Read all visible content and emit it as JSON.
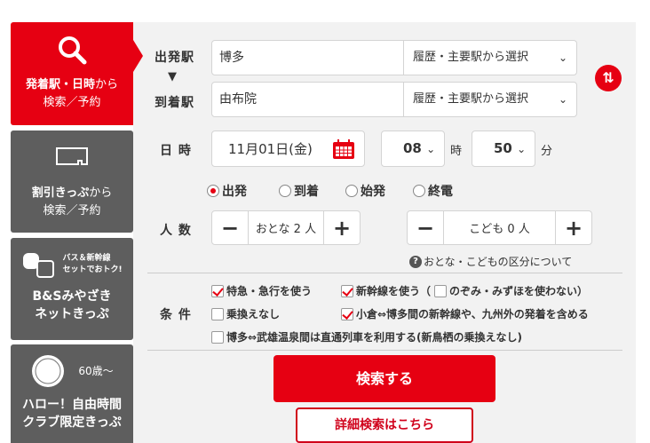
{
  "sidebar": {
    "items": [
      {
        "label_bold": "発着駅・日時",
        "label_rest": "から",
        "label2": "検索／予約",
        "active": true
      },
      {
        "label_bold": "割引きっぷ",
        "label_rest": "から",
        "label2": "検索／予約"
      },
      {
        "badge": "バス＆新幹線\nセットでおトク!",
        "label": "B&Sみやざき",
        "label2": "ネットきっぷ"
      },
      {
        "badge": "60歳～",
        "label": "ハロー！自由時間",
        "label2": "クラブ限定きっぷ"
      }
    ]
  },
  "form": {
    "from_label": "出発駅",
    "from_value": "博多",
    "from_select": "履歴・主要駅から選択",
    "to_label": "到着駅",
    "to_value": "由布院",
    "to_select": "履歴・主要駅から選択",
    "datetime_label": "日 時",
    "date_value": "11月01日(金)",
    "hour": "08",
    "hour_unit": "時",
    "minute": "50",
    "minute_unit": "分",
    "time_types": [
      "出発",
      "到着",
      "始発",
      "終電"
    ],
    "time_type_selected": 0,
    "people_label": "人 数",
    "adult": "おとな 2 人",
    "child": "こども 0 人",
    "minus": "−",
    "plus": "+",
    "help": "おとな・こどもの区分について",
    "cond_label": "条 件",
    "conditions": [
      {
        "label": "特急・急行を使う",
        "checked": true
      },
      {
        "label": "新幹線を使う（",
        "checked": true
      },
      {
        "label": "のぞみ・みずほを使わない）",
        "checked": false
      },
      {
        "label": "乗換えなし",
        "checked": false
      },
      {
        "label": "小倉⇔博多間の新幹線や、九州外の発着を含める",
        "checked": true
      },
      {
        "label": "博多⇔武雄温泉間は直通列車を利用する(新鳥栖の乗換えなし)",
        "checked": false
      }
    ],
    "search": "検索する",
    "detail": "詳細検索はこちら"
  },
  "colors": {
    "accent": "#e60012",
    "tab": "#5e5e5e"
  }
}
